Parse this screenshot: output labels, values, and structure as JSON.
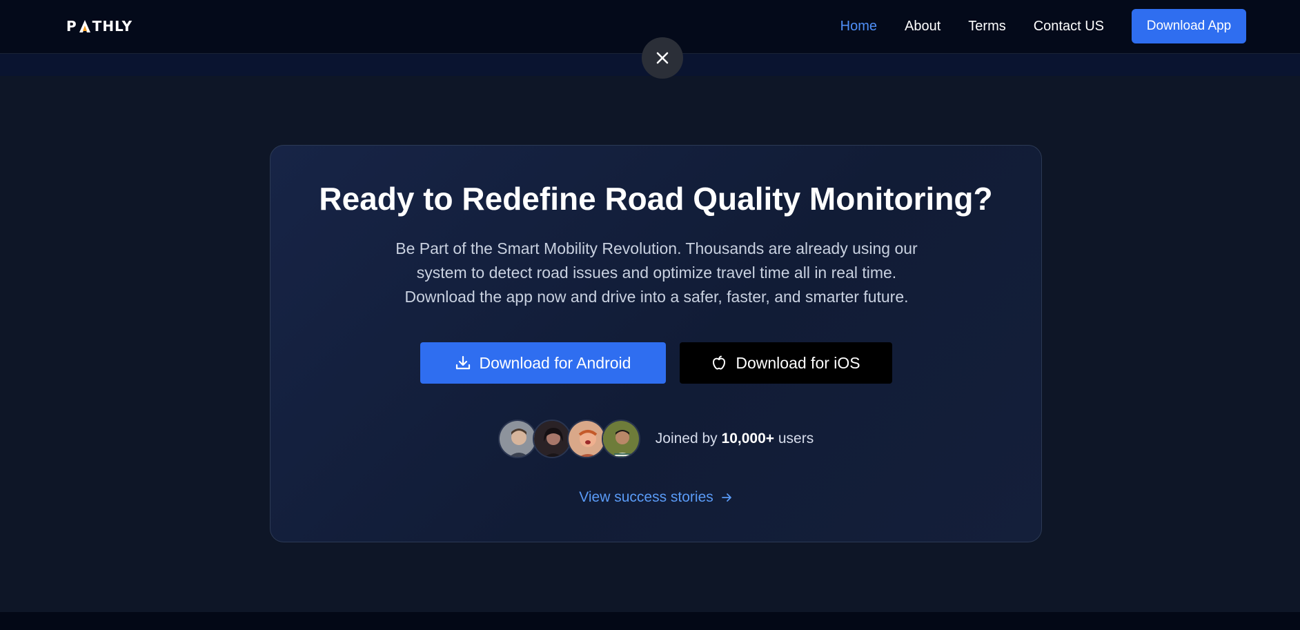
{
  "header": {
    "logo_text_left": "P",
    "logo_text_right": "THLY",
    "nav": {
      "home": "Home",
      "about": "About",
      "terms": "Terms",
      "contact": "Contact US"
    },
    "cta": "Download App"
  },
  "card": {
    "title": "Ready to Redefine Road Quality Monitoring?",
    "description_line1": "Be Part of the Smart Mobility Revolution. Thousands are already using our",
    "description_line2": "system to detect road issues and optimize travel time all in real time.",
    "description_line3": "Download the app now and drive into a safer, faster, and smarter future.",
    "android_button": "Download for Android",
    "ios_button": "Download for iOS",
    "joined_prefix": "Joined by",
    "joined_count": "10,000+",
    "joined_suffix": "users",
    "stories_link": "View success stories"
  },
  "icons": {
    "close": "close-icon",
    "download": "download-icon",
    "apple": "apple-icon",
    "arrow": "arrow-right-icon"
  },
  "colors": {
    "accent": "#2f6ef0",
    "link": "#5a9bf7",
    "active_nav": "#4f8ff7"
  }
}
